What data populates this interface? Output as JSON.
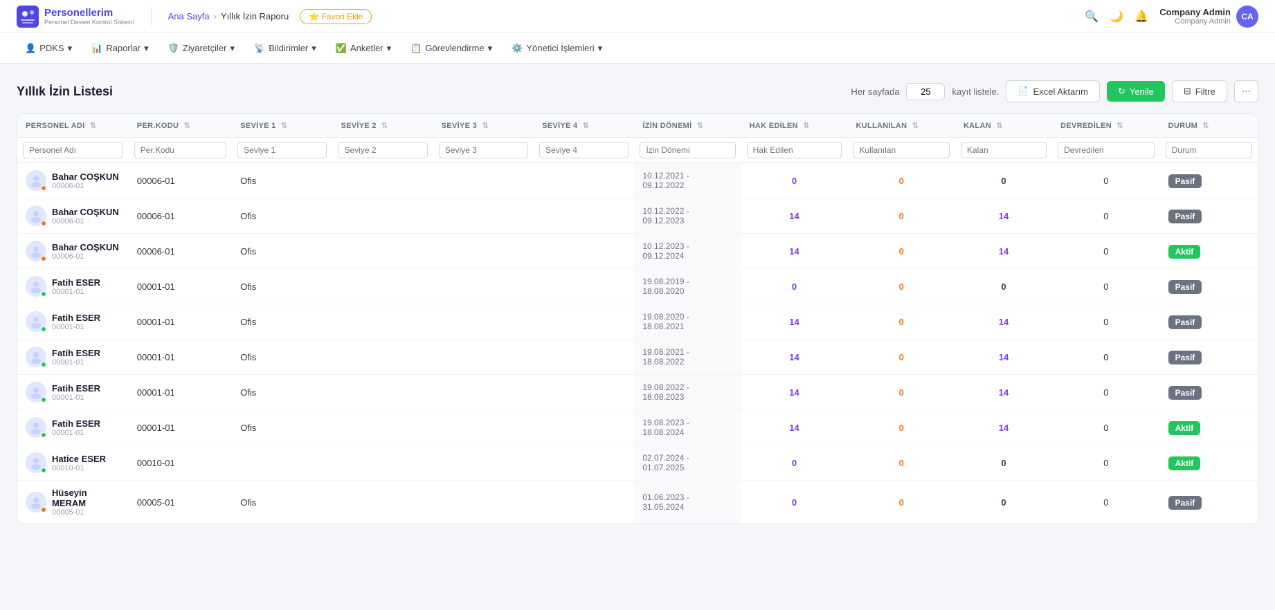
{
  "app": {
    "logo_main": "Personellerim",
    "logo_sub": "Personel Devam Kontrol Sistemi",
    "logo_initials": "CA"
  },
  "breadcrumb": {
    "home": "Ana Sayfa",
    "current": "Yıllık İzin Raporu"
  },
  "fav_btn": "⭐ Favori Ekle",
  "user": {
    "name": "Company Admin",
    "role": "Company Admin",
    "initials": "CA"
  },
  "nav": {
    "items": [
      {
        "icon": "👤",
        "label": "PDKS",
        "arrow": "▾"
      },
      {
        "icon": "📊",
        "label": "Raporlar",
        "arrow": "▾"
      },
      {
        "icon": "🛡️",
        "label": "Ziyaretçiler",
        "arrow": "▾"
      },
      {
        "icon": "📡",
        "label": "Bildirimler",
        "arrow": "▾"
      },
      {
        "icon": "✅",
        "label": "Anketler",
        "arrow": "▾"
      },
      {
        "icon": "📋",
        "label": "Görevlendirme",
        "arrow": "▾"
      },
      {
        "icon": "⚙️",
        "label": "Yönetici İşlemleri",
        "arrow": "▾"
      }
    ]
  },
  "page": {
    "title": "Yıllık İzin Listesi",
    "per_page_label": "Her sayfada",
    "per_page_value": "25",
    "kayit_label": "kayıt listele.",
    "btn_excel": "Excel Aktarım",
    "btn_yenile": "Yenile",
    "btn_filtre": "Filtre",
    "btn_more": "⋯"
  },
  "table": {
    "columns": [
      {
        "key": "personel_adi",
        "label": "PERSONEL ADI"
      },
      {
        "key": "per_kodu",
        "label": "PER.KODU"
      },
      {
        "key": "seviye1",
        "label": "SEVİYE 1"
      },
      {
        "key": "seviye2",
        "label": "SEVİYE 2"
      },
      {
        "key": "seviye3",
        "label": "SEVİYE 3"
      },
      {
        "key": "seviye4",
        "label": "SEVİYE 4"
      },
      {
        "key": "izin_donemi",
        "label": "İZİN DÖNEMİ"
      },
      {
        "key": "hak_edilen",
        "label": "HAK EDİLEN"
      },
      {
        "key": "kullanilan",
        "label": "KULLANILAN"
      },
      {
        "key": "kalan",
        "label": "KALAN"
      },
      {
        "key": "devredilen",
        "label": "DEVREDİLEN"
      },
      {
        "key": "durum",
        "label": "DURUM"
      }
    ],
    "filters": {
      "personel_adi": "Personel Adı",
      "per_kodu": "Per.Kodu",
      "seviye1": "Seviye 1",
      "seviye2": "Seviye 2",
      "seviye3": "Seviye 3",
      "seviye4": "Seviye 4",
      "izin_donemi": "İzin Dönemi",
      "hak_edilen": "Hak Edilen",
      "kullanilan": "Kullanılan",
      "kalan": "Kalan",
      "devredilen": "Devredilen",
      "durum": "Durum"
    },
    "rows": [
      {
        "name": "Bahar COŞKUN",
        "code": "00006-01",
        "per_kodu": "00006-01",
        "seviye1": "Ofis",
        "seviye2": "",
        "seviye3": "",
        "seviye4": "",
        "izin_donemi": "10.12.2021 - 09.12.2022",
        "hak_edilen": "0",
        "hak_color": "num-purple",
        "kullanilan": "0",
        "kul_color": "num-orange",
        "kalan": "0",
        "kal_color": "num-normal",
        "devredilen": "0",
        "durum": "Pasif",
        "durum_class": "badge-pasif",
        "dot": "dot-orange"
      },
      {
        "name": "Bahar COŞKUN",
        "code": "00006-01",
        "per_kodu": "00006-01",
        "seviye1": "Ofis",
        "seviye2": "",
        "seviye3": "",
        "seviye4": "",
        "izin_donemi": "10.12.2022 - 09.12.2023",
        "hak_edilen": "14",
        "hak_color": "num-purple",
        "kullanilan": "0",
        "kul_color": "num-orange",
        "kalan": "14",
        "kal_color": "num-purple",
        "devredilen": "0",
        "durum": "Pasif",
        "durum_class": "badge-pasif",
        "dot": "dot-orange"
      },
      {
        "name": "Bahar COŞKUN",
        "code": "00006-01",
        "per_kodu": "00006-01",
        "seviye1": "Ofis",
        "seviye2": "",
        "seviye3": "",
        "seviye4": "",
        "izin_donemi": "10.12.2023 - 09.12.2024",
        "hak_edilen": "14",
        "hak_color": "num-purple",
        "kullanilan": "0",
        "kul_color": "num-orange",
        "kalan": "14",
        "kal_color": "num-purple",
        "devredilen": "0",
        "durum": "Aktif",
        "durum_class": "badge-aktif",
        "dot": "dot-orange"
      },
      {
        "name": "Fatih ESER",
        "code": "00001-01",
        "per_kodu": "00001-01",
        "seviye1": "Ofis",
        "seviye2": "",
        "seviye3": "",
        "seviye4": "",
        "izin_donemi": "19.08.2019 - 18.08.2020",
        "hak_edilen": "0",
        "hak_color": "num-purple",
        "kullanilan": "0",
        "kul_color": "num-orange",
        "kalan": "0",
        "kal_color": "num-normal",
        "devredilen": "0",
        "durum": "Pasif",
        "durum_class": "badge-pasif",
        "dot": "dot-green"
      },
      {
        "name": "Fatih ESER",
        "code": "00001-01",
        "per_kodu": "00001-01",
        "seviye1": "Ofis",
        "seviye2": "",
        "seviye3": "",
        "seviye4": "",
        "izin_donemi": "19.08.2020 - 18.08.2021",
        "hak_edilen": "14",
        "hak_color": "num-purple",
        "kullanilan": "0",
        "kul_color": "num-orange",
        "kalan": "14",
        "kal_color": "num-purple",
        "devredilen": "0",
        "durum": "Pasif",
        "durum_class": "badge-pasif",
        "dot": "dot-green"
      },
      {
        "name": "Fatih ESER",
        "code": "00001-01",
        "per_kodu": "00001-01",
        "seviye1": "Ofis",
        "seviye2": "",
        "seviye3": "",
        "seviye4": "",
        "izin_donemi": "19.08.2021 - 18.08.2022",
        "hak_edilen": "14",
        "hak_color": "num-purple",
        "kullanilan": "0",
        "kul_color": "num-orange",
        "kalan": "14",
        "kal_color": "num-purple",
        "devredilen": "0",
        "durum": "Pasif",
        "durum_class": "badge-pasif",
        "dot": "dot-green"
      },
      {
        "name": "Fatih ESER",
        "code": "00001-01",
        "per_kodu": "00001-01",
        "seviye1": "Ofis",
        "seviye2": "",
        "seviye3": "",
        "seviye4": "",
        "izin_donemi": "19.08.2022 - 18.08.2023",
        "hak_edilen": "14",
        "hak_color": "num-purple",
        "kullanilan": "0",
        "kul_color": "num-orange",
        "kalan": "14",
        "kal_color": "num-purple",
        "devredilen": "0",
        "durum": "Pasif",
        "durum_class": "badge-pasif",
        "dot": "dot-green"
      },
      {
        "name": "Fatih ESER",
        "code": "00001-01",
        "per_kodu": "00001-01",
        "seviye1": "Ofis",
        "seviye2": "",
        "seviye3": "",
        "seviye4": "",
        "izin_donemi": "19.08.2023 - 18.08.2024",
        "hak_edilen": "14",
        "hak_color": "num-purple",
        "kullanilan": "0",
        "kul_color": "num-orange",
        "kalan": "14",
        "kal_color": "num-purple",
        "devredilen": "0",
        "durum": "Aktif",
        "durum_class": "badge-aktif",
        "dot": "dot-green"
      },
      {
        "name": "Hatice ESER",
        "code": "00010-01",
        "per_kodu": "00010-01",
        "seviye1": "",
        "seviye2": "",
        "seviye3": "",
        "seviye4": "",
        "izin_donemi": "02.07.2024 - 01.07.2025",
        "hak_edilen": "0",
        "hak_color": "num-purple",
        "kullanilan": "0",
        "kul_color": "num-orange",
        "kalan": "0",
        "kal_color": "num-normal",
        "devredilen": "0",
        "durum": "Aktif",
        "durum_class": "badge-aktif",
        "dot": "dot-green"
      },
      {
        "name": "Hüseyin MERAM",
        "code": "00005-01",
        "per_kodu": "00005-01",
        "seviye1": "Ofis",
        "seviye2": "",
        "seviye3": "",
        "seviye4": "",
        "izin_donemi": "01.06.2023 - 31.05.2024",
        "hak_edilen": "0",
        "hak_color": "num-purple",
        "kullanilan": "0",
        "kul_color": "num-orange",
        "kalan": "0",
        "kal_color": "num-normal",
        "devredilen": "0",
        "durum": "Pasif",
        "durum_class": "badge-pasif",
        "dot": "dot-orange"
      }
    ]
  }
}
